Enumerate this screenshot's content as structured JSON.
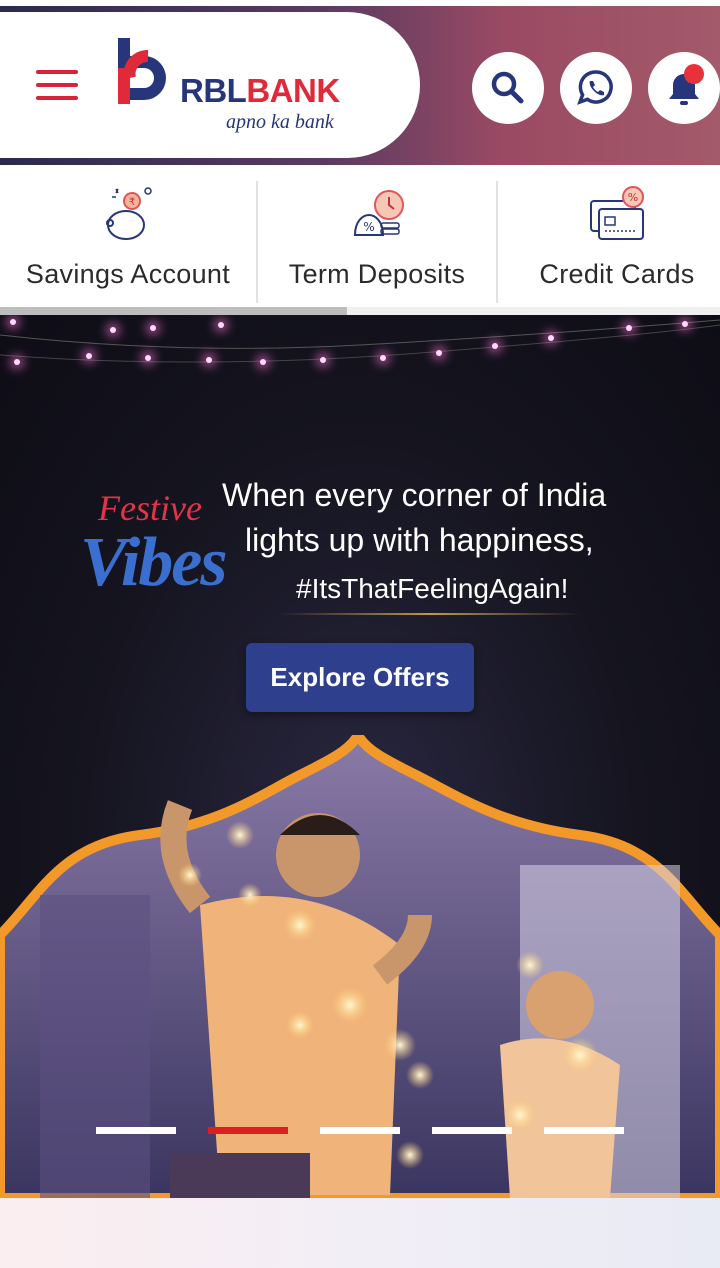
{
  "header": {
    "brand": {
      "name_part1": "RBL",
      "name_part2": "BANK",
      "tagline": "apno ka bank"
    },
    "icons": {
      "menu": "hamburger-menu-icon",
      "search": "search-icon",
      "whatsapp": "whatsapp-icon",
      "notifications": "bell-icon"
    },
    "colors": {
      "brand_blue": "#27357a",
      "brand_red": "#e02a3a"
    }
  },
  "quick_nav": {
    "items": [
      {
        "label": "Savings Account",
        "icon": "piggy-bank-icon"
      },
      {
        "label": "Term Deposits",
        "icon": "deposit-clock-icon"
      },
      {
        "label": "Credit Cards",
        "icon": "credit-card-icon"
      }
    ]
  },
  "banner": {
    "badge_line1": "Festive",
    "badge_line2": "Vibes",
    "headline_line1": "When every corner of India",
    "headline_line2": "lights up with happiness,",
    "hashtag": "#ItsThatFeelingAgain!",
    "cta_label": "Explore Offers",
    "carousel": {
      "slide_count": 5,
      "active_index": 1
    }
  }
}
